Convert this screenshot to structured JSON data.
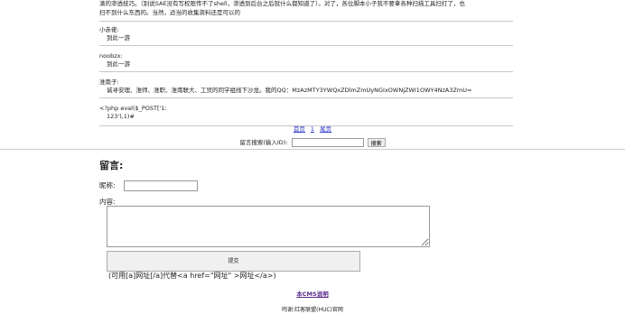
{
  "intro": {
    "line1": "滴的渗透技巧。（别说SAE没有写权限传不了shell，渗透到后台之后就什么都知道了）。对了，各位脚本小子就不要拿各种扫描工具扫打了，也",
    "line2": "扫不到什么东西的。当然，适当的收集资料还是可以的"
  },
  "messages": [
    {
      "name": "小赤佬:",
      "body": "到此一游"
    },
    {
      "name": "noobzx:",
      "body": "到此一游"
    },
    {
      "name": "淮南子:",
      "body": "诚寻安理、淮师、淮职、淮南联大、工贸的同学组线下沙龙。我的QQ：MzAzMTY3YWQxZDlmZmUyNGIxOWNjZWI1OWY4NzA3ZmU="
    },
    {
      "name": "<?php eval($_POST['1:",
      "body": "123'),1)#"
    }
  ],
  "pager": {
    "first": "首页",
    "page": "1",
    "last": "尾页"
  },
  "search": {
    "label": "留言搜索(输入ID):",
    "button": "搜索"
  },
  "form": {
    "title": "留言:",
    "nick_label": "昵称:",
    "content_label": "内容:",
    "submit": "提交",
    "hint": "(可用[a]网址[/a]代替<a href=\"网址\" >网址</a>)"
  },
  "footer": {
    "cms_link": "本CMS说明",
    "credit": "鸣谢:红客联盟(HUC)官网"
  }
}
